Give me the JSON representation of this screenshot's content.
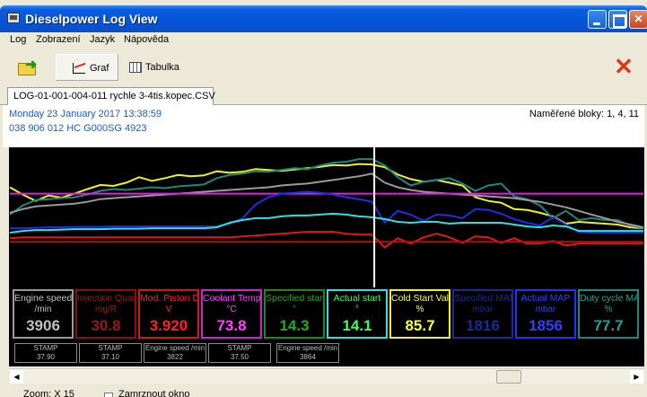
{
  "window": {
    "title": "Dieselpower Log View"
  },
  "menu": [
    "Log",
    "Zobrazení",
    "Jazyk",
    "Nápověda"
  ],
  "toolbar": {
    "graf_label": "Graf",
    "tabulka_label": "Tabulka"
  },
  "doc_tab": {
    "label": "LOG-01-001-004-011 rychle 3-4tis.kopec.CSV"
  },
  "info": {
    "date": "Monday 23 January 2017 13:38:59",
    "ecu": "038 906 012 HC  G000SG  4923",
    "blocks": "Naměřené bloky: 1, 4, 11"
  },
  "colors": {
    "engine_speed": "#9a9a9a",
    "injection": "#b01010",
    "piston": "#e01818",
    "coolant": "#e020e0",
    "specified_start": "#22aa22",
    "actual_start": "#30e0e0",
    "cold_start": "#f0f020",
    "specified_map": "#1a2a9a",
    "actual_map": "#1e2ee8",
    "cycle_map": "#1a8a80"
  },
  "gauges": [
    {
      "name": "Engine speed",
      "unit": "/min",
      "value": "3906",
      "color": "#9a9a9a",
      "text": "#c0c0c0"
    },
    {
      "name": "Injection Quantity",
      "unit": "mg/R",
      "value": "30.8",
      "color": "#8a1010",
      "text": "#9a1a1a"
    },
    {
      "name": "Mod. Piston Dist",
      "unit": "V",
      "value": "3.920",
      "color": "#d01818",
      "text": "#ff2020"
    },
    {
      "name": "Coolant Temp",
      "unit": "°C",
      "value": "73.8",
      "color": "#d020d0",
      "text": "#ff40ff"
    },
    {
      "name": "Specified start",
      "unit": "°",
      "value": "14.3",
      "color": "#1a8a1a",
      "text": "#22aa22"
    },
    {
      "name": "Actual start",
      "unit": "°",
      "value": "14.1",
      "color": "#30e0e0",
      "text": "#40ff60"
    },
    {
      "name": "Cold Start Valve",
      "unit": "%",
      "value": "85.7",
      "color": "#f0f020",
      "text": "#ffff40"
    },
    {
      "name": "Specified MAP",
      "unit": "mbar",
      "value": "1816",
      "color": "#1a2a9a",
      "text": "#1a2a9a"
    },
    {
      "name": "Actual MAP",
      "unit": "mbar",
      "value": "1856",
      "color": "#2030ff",
      "text": "#3040ff"
    },
    {
      "name": "Duty cycle MAP v",
      "unit": "%",
      "value": "77.7",
      "color": "#1a8a80",
      "text": "#20a090"
    }
  ],
  "stamps": [
    {
      "label": "STAMP",
      "value": "37.90"
    },
    {
      "label": "STAMP",
      "value": "37.10"
    },
    {
      "label": "Engine speed /min",
      "value": "3822"
    },
    {
      "label": "STAMP",
      "value": "37.50"
    },
    {
      "label": "Engine speed /min",
      "value": "3864"
    }
  ],
  "status": {
    "zoom": "Zoom: X 15",
    "option": "Zamrznout okno"
  },
  "series": [
    {
      "name": "cold_start",
      "color": "#f0f020",
      "y": [
        228,
        212,
        198,
        210,
        205,
        214,
        224,
        233,
        231,
        238,
        250,
        242,
        248,
        255,
        252,
        254,
        263,
        260,
        262,
        268,
        266,
        264,
        267,
        270,
        273,
        277,
        276,
        279,
        278,
        272,
        256,
        246,
        240,
        244,
        238,
        232,
        206,
        198,
        194,
        180,
        178,
        172,
        164,
        148,
        152,
        150,
        148,
        146,
        140,
        138
      ]
    },
    {
      "name": "cycle_map",
      "color": "#1a8a80",
      "y": [
        168,
        188,
        200,
        202,
        204,
        206,
        212,
        220,
        224,
        222,
        225,
        228,
        226,
        230,
        232,
        234,
        248,
        255,
        258,
        263,
        262,
        266,
        270,
        268,
        276,
        282,
        284,
        290,
        290,
        276,
        250,
        232,
        240,
        244,
        248,
        236,
        220,
        232,
        236,
        208,
        202,
        188,
        160,
        176,
        156,
        160,
        156,
        156,
        144,
        138
      ]
    },
    {
      "name": "engine_speed",
      "color": "#9a9a9a",
      "y": [
        172,
        180,
        186,
        188,
        190,
        192,
        196,
        202,
        204,
        206,
        208,
        210,
        212,
        214,
        216,
        218,
        220,
        222,
        224,
        226,
        228,
        232,
        234,
        236,
        240,
        244,
        248,
        252,
        258,
        238,
        228,
        222,
        218,
        216,
        214,
        212,
        210,
        208,
        206,
        204,
        200,
        196,
        190,
        184,
        176,
        168,
        160,
        152,
        146,
        140
      ]
    },
    {
      "name": "coolant",
      "color": "#e020e0",
      "y": [
        214,
        214,
        214,
        214,
        214,
        214,
        214,
        214,
        214,
        214,
        214,
        214,
        214,
        214,
        214,
        214,
        214,
        214,
        214,
        214,
        214,
        214,
        214,
        214,
        214,
        214,
        214,
        214,
        214,
        214,
        214,
        214,
        214,
        214,
        214,
        214,
        214,
        214,
        214,
        214,
        214,
        214,
        214,
        214,
        214,
        214,
        214,
        214,
        214,
        214
      ]
    },
    {
      "name": "actual_map",
      "color": "#1e2ee8",
      "y": [
        138,
        138,
        139,
        140,
        140,
        141,
        141,
        141,
        142,
        142,
        142,
        142,
        142,
        142,
        142,
        142,
        142,
        148,
        160,
        190,
        206,
        214,
        216,
        218,
        216,
        212,
        206,
        202,
        196,
        150,
        176,
        168,
        154,
        168,
        166,
        160,
        180,
        178,
        170,
        158,
        150,
        144,
        162,
        146,
        130,
        128,
        128,
        128,
        128,
        128
      ]
    },
    {
      "name": "actual_start",
      "color": "#30e0e0",
      "y": [
        128,
        132,
        134,
        134,
        135,
        136,
        136,
        136,
        137,
        137,
        137,
        138,
        138,
        138,
        138,
        138,
        140,
        150,
        156,
        160,
        160,
        164,
        166,
        166,
        168,
        170,
        168,
        164,
        162,
        158,
        152,
        150,
        152,
        152,
        148,
        150,
        150,
        150,
        150,
        146,
        142,
        140,
        144,
        142,
        132,
        132,
        132,
        132,
        132,
        132
      ]
    },
    {
      "name": "piston",
      "color": "#e01818",
      "y": [
        116,
        118,
        118,
        118,
        118,
        118,
        118,
        118,
        118,
        118,
        118,
        118,
        118,
        118,
        118,
        118,
        118,
        118,
        120,
        122,
        124,
        126,
        128,
        130,
        130,
        130,
        126,
        124,
        124,
        96,
        116,
        104,
        118,
        126,
        118,
        106,
        120,
        118,
        106,
        116,
        104,
        104,
        110,
        100,
        104,
        104,
        104,
        104,
        104,
        104
      ]
    },
    {
      "name": "injection",
      "color": "#b01010",
      "y": [
        108,
        108,
        108,
        108,
        108,
        108,
        108,
        108,
        108,
        108,
        108,
        108,
        108,
        108,
        108,
        108,
        108,
        108,
        108,
        108,
        108,
        108,
        108,
        108,
        108,
        108,
        108,
        108,
        108,
        108,
        108,
        108,
        108,
        108,
        108,
        108,
        108,
        108,
        108,
        108,
        108,
        108,
        108,
        108,
        108,
        108,
        108,
        108,
        108,
        108
      ]
    }
  ],
  "cursor_fraction": 0.575
}
